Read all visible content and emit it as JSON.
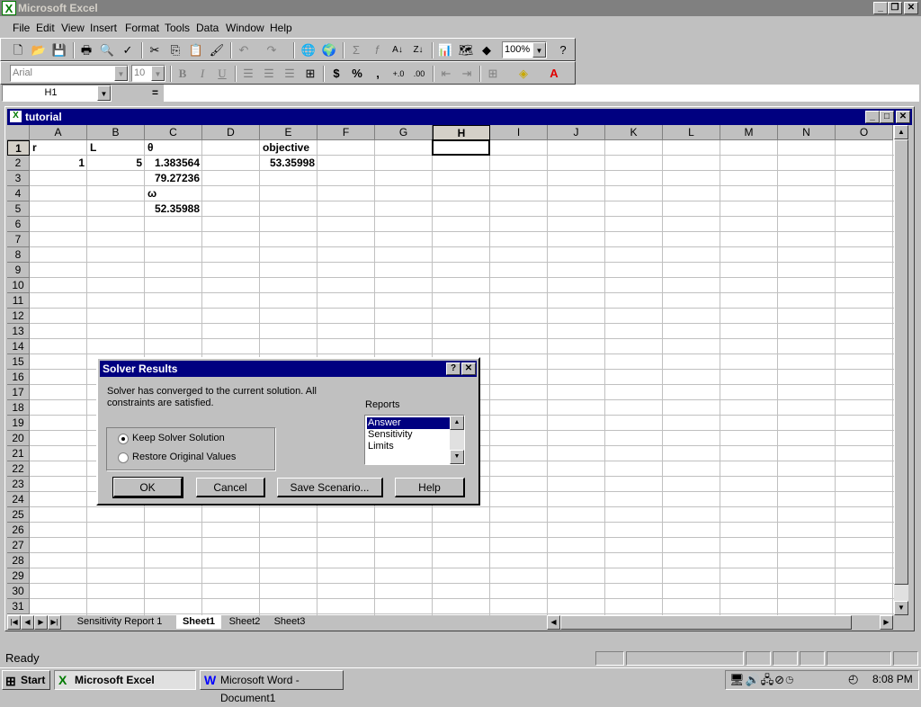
{
  "app": {
    "title": "Microsoft Excel"
  },
  "menu": [
    "File",
    "Edit",
    "View",
    "Insert",
    "Format",
    "Tools",
    "Data",
    "Window",
    "Help"
  ],
  "toolbar": {
    "zoom": "100%",
    "font": "Arial",
    "size": "10",
    "bold": "B",
    "italic": "I",
    "underline": "U",
    "currency": "$",
    "percent": "%",
    "comma": ","
  },
  "formula_bar": {
    "name_box": "H1",
    "equals": "=",
    "content": ""
  },
  "workbook": {
    "title": "tutorial",
    "columns": [
      "A",
      "B",
      "C",
      "D",
      "E",
      "F",
      "G",
      "H",
      "I",
      "J",
      "K",
      "L",
      "M",
      "N",
      "O"
    ],
    "rows": [
      "1",
      "2",
      "3",
      "4",
      "5",
      "6",
      "7",
      "8",
      "9",
      "10",
      "11",
      "12",
      "13",
      "14",
      "15",
      "16",
      "17",
      "18",
      "19",
      "20",
      "21",
      "22",
      "23",
      "24",
      "25",
      "26",
      "27",
      "28",
      "29",
      "30",
      "31"
    ],
    "active_cell": "H1",
    "cells": {
      "A1": "r",
      "B1": "L",
      "C1": "θ",
      "E1": "objective",
      "A2": "1",
      "B2": "5",
      "C2": "1.383564",
      "E2": "53.35998",
      "C3": "79.27236",
      "C4": "ω",
      "C5": "52.35988"
    },
    "tabs": [
      "Sensitivity Report 1",
      "Sheet1",
      "Sheet2",
      "Sheet3"
    ],
    "active_tab": "Sheet1"
  },
  "dialog": {
    "title": "Solver Results",
    "message": "Solver has converged to the current solution.  All constraints are satisfied.",
    "reports_label": "Reports",
    "reports": [
      "Answer",
      "Sensitivity",
      "Limits"
    ],
    "option_keep": "Keep Solver Solution",
    "option_restore": "Restore Original Values",
    "ok": "OK",
    "cancel": "Cancel",
    "save_scenario": "Save Scenario...",
    "help": "Help"
  },
  "status": {
    "text": "Ready"
  },
  "taskbar": {
    "start": "Start",
    "task1": "Microsoft Excel",
    "task2": "Microsoft Word - Document1",
    "clock": "8:08 PM"
  }
}
